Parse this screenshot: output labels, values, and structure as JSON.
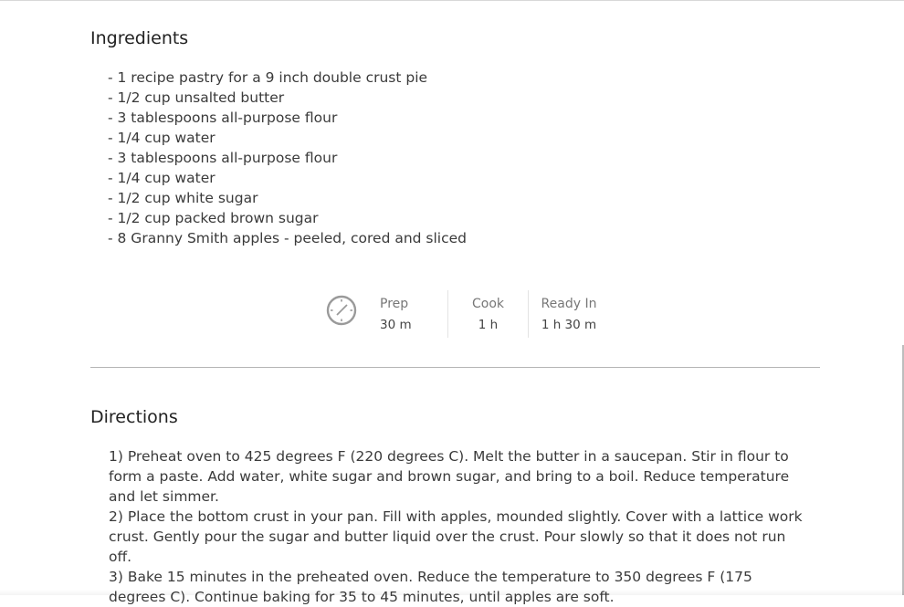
{
  "ingredients": {
    "title": "Ingredients",
    "items": [
      "- 1 recipe pastry for a 9 inch double crust pie",
      "- 1/2 cup unsalted butter",
      "- 3 tablespoons all-purpose flour",
      "- 1/4 cup water",
      "- 3 tablespoons all-purpose flour",
      "- 1/4 cup water",
      "- 1/2 cup white sugar",
      "- 1/2 cup packed brown sugar",
      "- 8 Granny Smith apples - peeled, cored and sliced"
    ]
  },
  "times": {
    "icon": "clock-icon",
    "prep": {
      "label": "Prep",
      "value": "30 m"
    },
    "cook": {
      "label": "Cook",
      "value": "1 h"
    },
    "ready": {
      "label": "Ready In",
      "value": "1 h 30 m"
    }
  },
  "directions": {
    "title": "Directions",
    "steps": [
      "1) Preheat oven to 425 degrees F (220 degrees C). Melt the butter in a saucepan. Stir in flour to form a paste. Add water, white sugar and brown sugar, and bring to a boil. Reduce temperature and let simmer.",
      "2) Place the bottom crust in your pan. Fill with apples, mounded slightly. Cover with a lattice work crust. Gently pour the sugar and butter liquid over the crust. Pour slowly so that it does not run off.",
      "3) Bake 15 minutes in the preheated oven. Reduce the temperature to 350 degrees F (175 degrees C). Continue baking for 35 to 45 minutes, until apples are soft."
    ]
  },
  "colors": {
    "text": "#333333",
    "muted": "#777777",
    "divider": "#b5b5b5"
  }
}
